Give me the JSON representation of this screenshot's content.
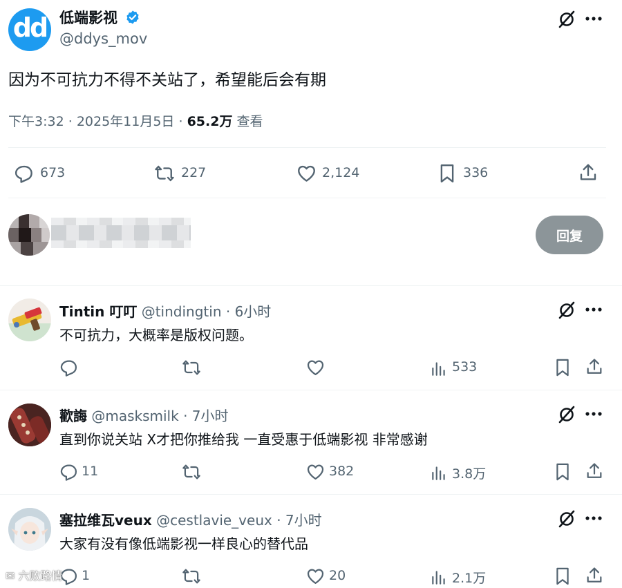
{
  "main_tweet": {
    "avatar_text": "dd",
    "display_name": "低端影视",
    "handle": "@ddys_mov",
    "text": "因为不可抗力不得不关站了，希望能后会有期",
    "time": "下午3:32",
    "date": "2025年11月5日",
    "views": "65.2万",
    "views_label": "查看",
    "stats": {
      "replies": "673",
      "reposts": "227",
      "likes": "2,124",
      "bookmarks": "336"
    }
  },
  "composer": {
    "reply_button": "回复"
  },
  "replies": [
    {
      "name": "Tintin 叮叮",
      "handle": "@tindingtin",
      "time": "6小时",
      "text": "不可抗力，大概率是版权问题。",
      "replies": "",
      "reposts": "",
      "likes": "",
      "views": "533"
    },
    {
      "name": "歡誨",
      "handle": "@masksmilk",
      "time": "7小时",
      "text": "直到你说关站 X才把你推给我 一直受惠于低端影视 非常感谢",
      "replies": "11",
      "reposts": "",
      "likes": "382",
      "views": "3.8万"
    },
    {
      "name": "塞拉维瓦veux",
      "handle": "@cestlavie_veux",
      "time": "7小时",
      "text": "大家有没有像低端影视一样良心的替代品",
      "replies": "1",
      "reposts": "",
      "likes": "20",
      "views": "2.1万"
    }
  ],
  "watermark": "六败路情",
  "colors": {
    "brand": "#1d9bf0",
    "muted": "#536471",
    "button": "#8c9599",
    "divider": "#eff3f4"
  }
}
